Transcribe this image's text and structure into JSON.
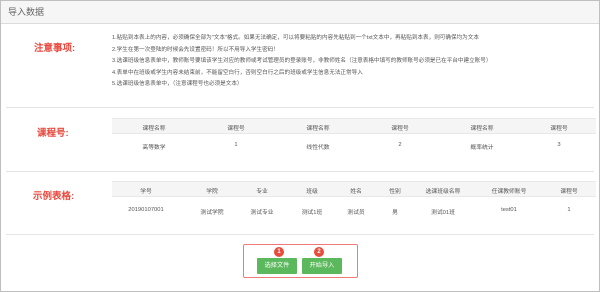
{
  "window": {
    "title": "导入数据"
  },
  "notes": {
    "label": "注意事项:",
    "lines": [
      "1.粘贴到本表上的内容，必须确保全部为\"文本\"格式。如果无法确定，可以将要粘贴的内容先粘贴到一个txt文本中，再粘贴到本表，则可确保均为文本",
      "2.学生在第一次登陆的时候会先设置密码！所以不用导入学生密码！",
      "3.选课班级信息表单中，教师账号要填该学生对应的教师或考试管理员的登录账号，非教师姓名（注意表格中填写的教师账号必须是已在平台中建立账号）",
      "4.表单中在班级或学生内容未结束前，不能留空白行，否则空白行之后的班级或学生信息无法正常导入",
      "5.选课班级信息表单中，（注意课程号也必须是文本）"
    ]
  },
  "course": {
    "label": "课程号:",
    "headers": [
      "课程名称",
      "课程号",
      "课程名称",
      "课程号",
      "课程名称",
      "课程号"
    ],
    "row": [
      "高等数学",
      "1",
      "线性代数",
      "2",
      "概率统计",
      "3"
    ]
  },
  "example": {
    "label": "示例表格:",
    "headers": [
      "学号",
      "学院",
      "专业",
      "班级",
      "姓名",
      "性别",
      "选课班级名称",
      "任课教师账号",
      "课程号"
    ],
    "row": [
      "20190107001",
      "测试学院",
      "测试专业",
      "测试1班",
      "测试员",
      "男",
      "测试01班",
      "test01",
      "1"
    ]
  },
  "actions": {
    "choose_file_label": "选择文件",
    "choose_file_badge": "1",
    "start_import_label": "开始导入",
    "start_import_badge": "2"
  },
  "colors": {
    "accent_red": "#e8493e",
    "button_green": "#5cb85c",
    "badge_red": "#e74c3c"
  }
}
